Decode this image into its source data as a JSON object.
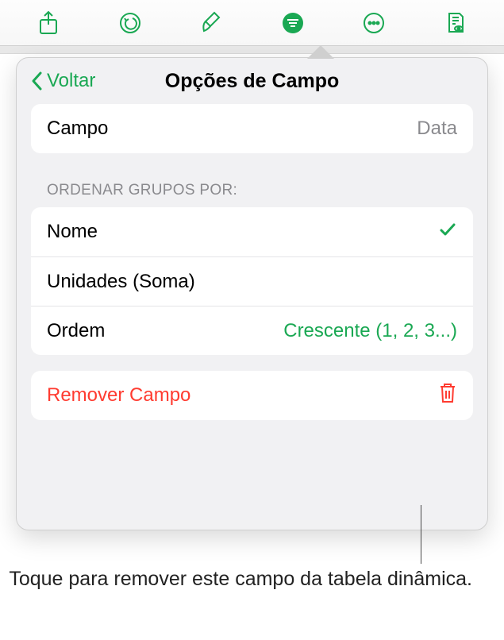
{
  "popover": {
    "back_label": "Voltar",
    "title": "Opções de Campo",
    "field_row": {
      "label": "Campo",
      "value": "Data"
    },
    "sort_section_header": "ORDENAR GRUPOS POR:",
    "sort_options": {
      "option1": "Nome",
      "option2": "Unidades (Soma)",
      "order_label": "Ordem",
      "order_value": "Crescente (1, 2, 3...)"
    },
    "remove_label": "Remover Campo"
  },
  "callout": {
    "text": "Toque para remover este campo da tabela dinâmica."
  }
}
